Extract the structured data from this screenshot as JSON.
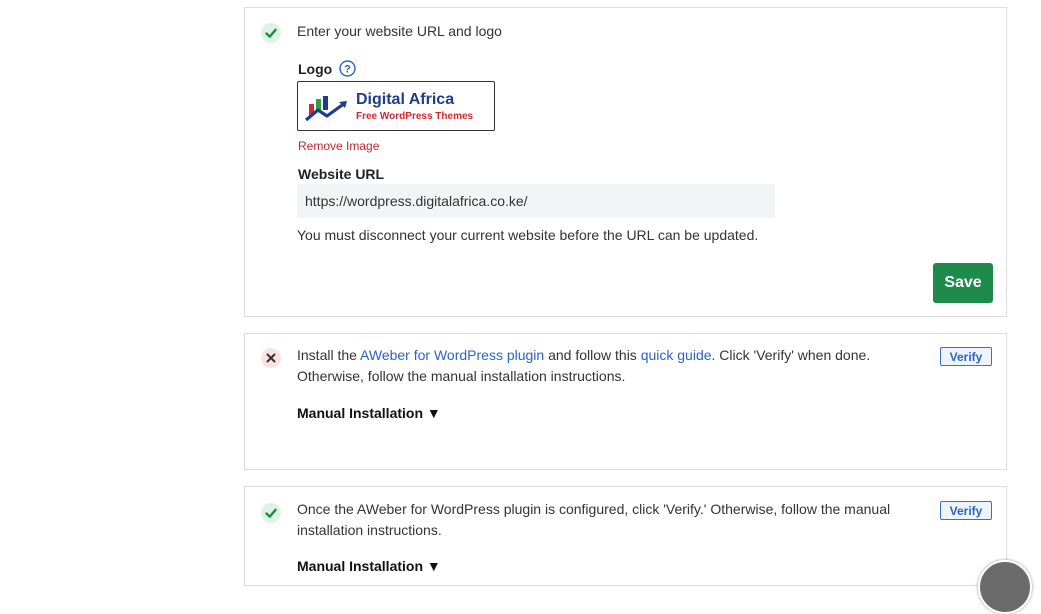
{
  "step1": {
    "text": "Enter your website URL and logo",
    "logo_label": "Logo",
    "logo_image": {
      "name": "Digital Africa",
      "tagline": "Free WordPress Themes"
    },
    "remove_image": "Remove Image",
    "url_label": "Website URL",
    "url_value": "https://wordpress.digitalafrica.co.ke/",
    "note": "You must disconnect your current website before the URL can be updated.",
    "save_label": "Save",
    "status": "complete"
  },
  "step2": {
    "text_before": "Install the ",
    "plugin_link": "AWeber for WordPress plugin",
    "text_middle": " and follow this ",
    "guide_link": "quick guide",
    "text_after": ". Click 'Verify' when done. Otherwise, follow the manual installation instructions.",
    "verify_label": "Verify",
    "manual_label": "Manual Installation ▼",
    "status": "incomplete"
  },
  "step3": {
    "text": "Once the AWeber for WordPress plugin is configured, click 'Verify.' Otherwise, follow the manual installation instructions.",
    "verify_label": "Verify",
    "manual_label": "Manual Installation ▼",
    "status": "complete"
  },
  "icons": {
    "check": "check-icon",
    "cross": "close-icon",
    "help": "help-icon"
  },
  "colors": {
    "success": "#1e8a4c",
    "error": "#c0272d",
    "link": "#2b63c6",
    "logo_blue": "#1f3d8c",
    "logo_red": "#d7262e"
  }
}
